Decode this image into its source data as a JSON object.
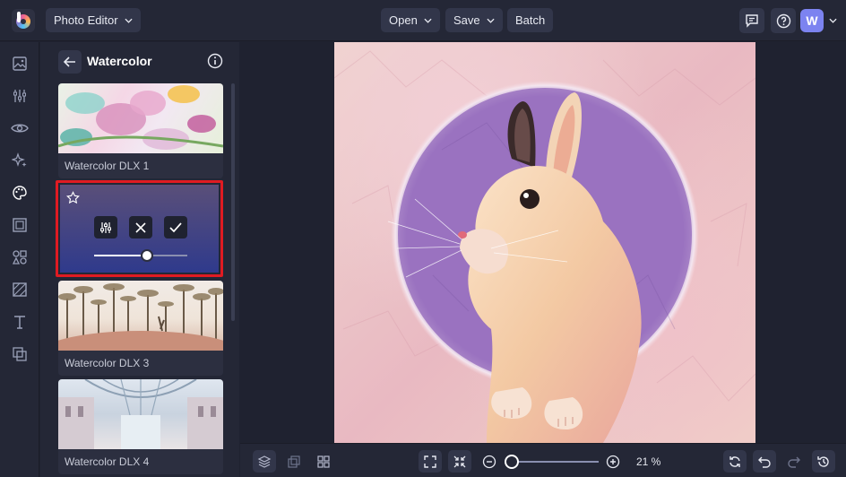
{
  "app": {
    "mode_label": "Photo Editor",
    "avatar_initial": "W"
  },
  "toolbar": {
    "open_label": "Open",
    "save_label": "Save",
    "batch_label": "Batch"
  },
  "panel": {
    "title": "Watercolor",
    "effects": [
      {
        "label": "Watercolor DLX 1"
      },
      {
        "label": "Watercolor DLX 3"
      },
      {
        "label": "Watercolor DLX 4"
      }
    ],
    "active_effect": {
      "intensity": 0.57
    }
  },
  "bottom": {
    "zoom_label": "21 %"
  },
  "colors": {
    "accent": "#7c83f0",
    "highlight": "#e01b22",
    "panel_bg": "#242736"
  }
}
